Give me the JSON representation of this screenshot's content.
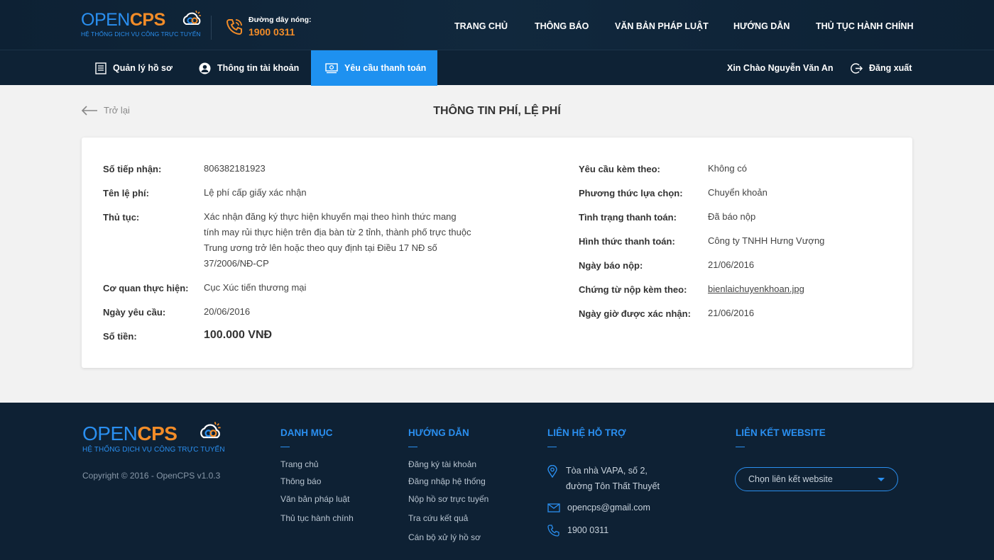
{
  "brand": {
    "name_part1": "OPEN",
    "name_part2": "CPS",
    "tagline": "HỆ THỐNG DỊCH VỤ CÔNG TRỰC TUYẾN",
    "primary_color": "#2a8ff0",
    "accent_color": "#f28c28"
  },
  "hotline": {
    "label": "Đường dây nóng:",
    "number": "1900 0311"
  },
  "main_nav": [
    "TRANG CHỦ",
    "THÔNG BÁO",
    "VĂN BẢN PHÁP LUẬT",
    "HƯỚNG DẪN",
    "THỦ TỤC HÀNH CHÍNH"
  ],
  "sub_nav": {
    "items": [
      {
        "label": "Quản lý hồ sơ",
        "icon": "document-icon"
      },
      {
        "label": "Thông tin tài khoản",
        "icon": "user-circle-icon"
      },
      {
        "label": "Yêu cầu thanh toán",
        "icon": "payment-icon",
        "active": true
      }
    ],
    "greeting": "Xin Chào Nguyễn Văn An",
    "logout": "Đăng xuất"
  },
  "page": {
    "back_label": "Trở lại",
    "title": "THÔNG TIN PHÍ, LỆ PHÍ"
  },
  "details_left": {
    "receipt_no": {
      "label": "Số tiếp nhận:",
      "value": "806382181923"
    },
    "fee_name": {
      "label": "Tên lệ phí:",
      "value": "Lệ phí cấp giấy xác nhận"
    },
    "procedure": {
      "label": "Thủ tục:",
      "value": "Xác nhận đăng ký thực hiện khuyến mại theo hình thức mang tính may rủi thực hiện trên địa bàn từ 2 tỉnh, thành phố trực thuộc Trung ương trở lên hoặc theo quy định tại Điều 17 NĐ số 37/2006/NĐ-CP"
    },
    "agency": {
      "label": "Cơ quan thực hiện:",
      "value": "Cục Xúc tiến thương mại"
    },
    "request_date": {
      "label": "Ngày yêu cầu:",
      "value": "20/06/2016"
    },
    "amount": {
      "label": "Số tiền:",
      "value": "100.000 VNĐ"
    }
  },
  "details_right": {
    "attached_request": {
      "label": "Yêu cầu kèm theo:",
      "value": "Không có"
    },
    "method": {
      "label": "Phương thức lựa chọn:",
      "value": "Chuyển khoản"
    },
    "status": {
      "label": "Tình trạng thanh toán:",
      "value": "Đã báo nộp"
    },
    "payment_form": {
      "label": "Hình thức thanh toán:",
      "value": "Công ty TNHH Hưng Vượng"
    },
    "report_date": {
      "label": "Ngày báo nộp:",
      "value": "21/06/2016"
    },
    "voucher": {
      "label": "Chứng từ nộp kèm theo:",
      "value": "bienlaichuyenkhoan.jpg"
    },
    "confirm_date": {
      "label": "Ngày giờ được xác nhận:",
      "value": "21/06/2016"
    }
  },
  "footer": {
    "copyright": "Copyright © 2016 - OpenCPS v1.0.3",
    "categories": {
      "title": "DANH MỤC",
      "links": [
        "Trang chủ",
        "Thông báo",
        "Văn bản pháp luật",
        "Thủ tục hành chính"
      ]
    },
    "guides": {
      "title": "HƯỚNG DẪN",
      "links": [
        "Đăng ký tài khoản",
        "Đăng nhập hệ thống",
        "Nộp hồ sơ trực tuyến",
        "Tra cứu kết quả",
        "Cán bộ xử lý hồ sơ"
      ]
    },
    "support": {
      "title": "LIÊN HỆ HỖ TRỢ",
      "address_line1": "Tòa nhà VAPA, số 2,",
      "address_line2": "đường Tôn Thất Thuyết",
      "email": "opencps@gmail.com",
      "phone": "1900 0311"
    },
    "websites": {
      "title": "LIÊN KẾT WEBSITE",
      "select_placeholder": "Chọn liên kết website"
    }
  }
}
